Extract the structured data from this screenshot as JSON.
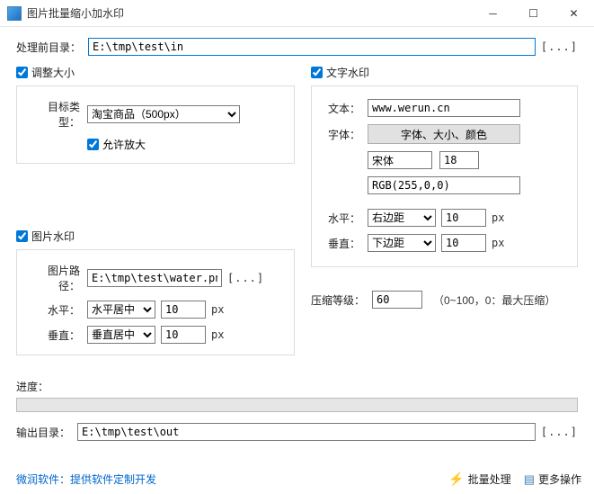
{
  "window": {
    "title": "图片批量缩小加水印"
  },
  "input_dir": {
    "label": "处理前目录：",
    "value": "E:\\tmp\\test\\in",
    "browse": "[...]"
  },
  "resize": {
    "checkbox_label": "调整大小",
    "target_label": "目标类型：",
    "target_value": "淘宝商品（500px）",
    "enlarge_label": "允许放大"
  },
  "img_wm": {
    "checkbox_label": "图片水印",
    "path_label": "图片路径：",
    "path_value": "E:\\tmp\\test\\water.png",
    "browse": "[...]",
    "h_label": "水平：",
    "h_select": "水平居中",
    "h_val": "10",
    "h_unit": "px",
    "v_label": "垂直：",
    "v_select": "垂直居中",
    "v_val": "10",
    "v_unit": "px"
  },
  "txt_wm": {
    "checkbox_label": "文字水印",
    "text_label": "文本：",
    "text_value": "www.werun.cn",
    "font_label": "字体：",
    "font_btn": "字体、大小、颜色",
    "font_name": "宋体",
    "font_size": "18",
    "font_color": "RGB(255,0,0)",
    "h_label": "水平：",
    "h_select": "右边距",
    "h_val": "10",
    "h_unit": "px",
    "v_label": "垂直：",
    "v_select": "下边距",
    "v_val": "10",
    "v_unit": "px"
  },
  "compress": {
    "label": "压缩等级：",
    "value": "60",
    "hint": "（0~100，0：最大压缩）"
  },
  "progress": {
    "label": "进度："
  },
  "output_dir": {
    "label": "输出目录：",
    "value": "E:\\tmp\\test\\out",
    "browse": "[...]"
  },
  "footer": {
    "link1": "微润软件：",
    "link2": "提供软件定制开发",
    "batch": "批量处理",
    "more": "更多操作"
  }
}
